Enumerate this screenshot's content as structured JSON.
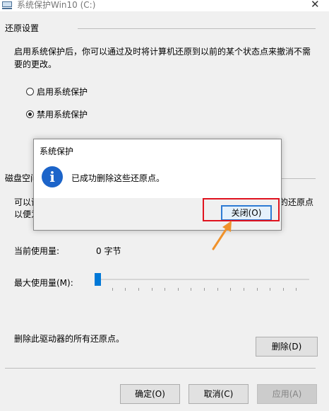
{
  "window": {
    "title": "系统保护Win10 (C:)",
    "close_glyph": "✕"
  },
  "restore_section": {
    "heading": "还原设置",
    "description_line1": "启用系统保护后，你可以通过及时将计算机还原到以前的某个状态点来撤消不需",
    "description_line2": "要的更改。",
    "options": [
      {
        "label": "启用系统保护",
        "selected": false
      },
      {
        "label": "禁用系统保护",
        "selected": true
      }
    ]
  },
  "disk_section": {
    "heading_partial": "磁盘空间",
    "description_left1": "可以调",
    "description_left2": "以便为",
    "description_right": "的还原点",
    "current_usage_label": "当前使用量:",
    "current_usage_value": "0 字节",
    "max_usage_label": "最大使用量(M):",
    "max_usage_fraction": 0
  },
  "delete_row": {
    "text": "删除此驱动器的所有还原点。",
    "button": "删除(D)"
  },
  "footer": {
    "ok": "确定(O)",
    "cancel": "取消(C)",
    "apply": "应用(A)"
  },
  "dialog": {
    "title": "系统保护",
    "icon": "info-icon",
    "icon_glyph": "i",
    "message": "已成功删除这些还原点。",
    "close_button": "关闭(O)"
  },
  "annotation": {
    "highlight_color": "#e0131f",
    "arrow_color": "#f0922b"
  }
}
